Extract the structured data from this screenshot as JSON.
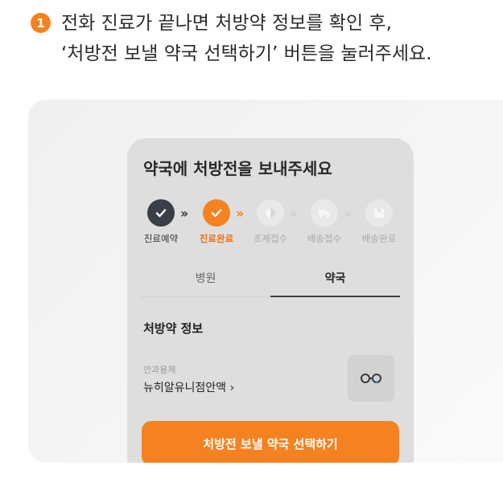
{
  "instruction": {
    "step_number": "1",
    "line1": "전화 진료가 끝나면 처방약 정보를 확인 후,",
    "line2": "‘처방전 보낼 약국 선택하기’ 버튼을 눌러주세요."
  },
  "card": {
    "title": "약국에 처방전을 보내주세요",
    "steps": [
      {
        "label": "진료예약",
        "state": "done"
      },
      {
        "label": "진료완료",
        "state": "current"
      },
      {
        "label": "조제접수",
        "state": "pending"
      },
      {
        "label": "배송접수",
        "state": "pending"
      },
      {
        "label": "배송완료",
        "state": "pending"
      }
    ],
    "tabs": [
      {
        "label": "병원",
        "selected": false
      },
      {
        "label": "약국",
        "selected": true
      }
    ],
    "section_title": "처방약 정보",
    "drug": {
      "category": "안과용제",
      "name": "뉴히알유니점안액 ›"
    },
    "cta_label": "처방전 보낼 약국 선택하기"
  },
  "colors": {
    "accent": "#f58220",
    "dark_step": "#3a3f47",
    "card_bg": "#dedede"
  }
}
